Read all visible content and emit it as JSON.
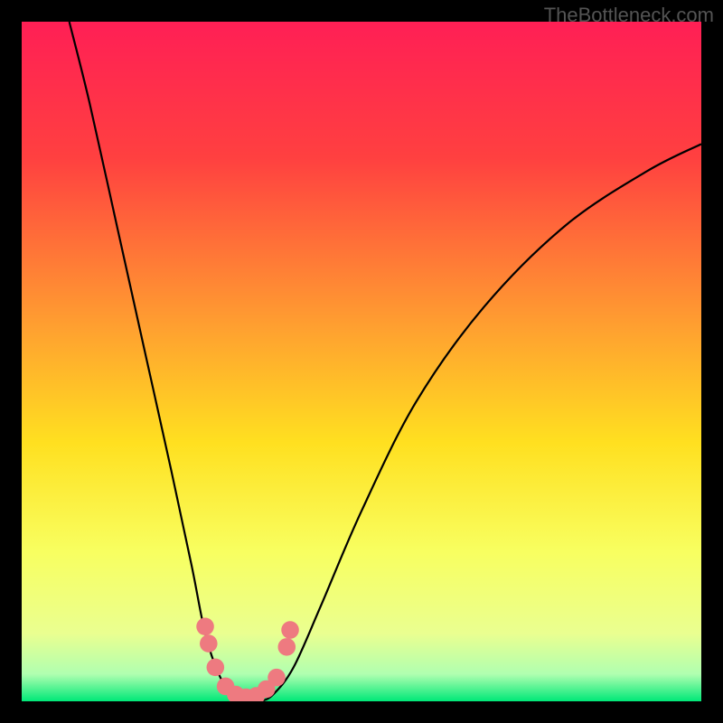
{
  "watermark": "TheBottleneck.com",
  "chart_data": {
    "type": "line",
    "title": "",
    "xlabel": "",
    "ylabel": "",
    "xlim": [
      0,
      100
    ],
    "ylim": [
      0,
      100
    ],
    "gradient_stops": [
      {
        "offset": 0,
        "color": "#ff1f55"
      },
      {
        "offset": 20,
        "color": "#ff4040"
      },
      {
        "offset": 45,
        "color": "#ffa030"
      },
      {
        "offset": 62,
        "color": "#ffe020"
      },
      {
        "offset": 78,
        "color": "#f8ff60"
      },
      {
        "offset": 90,
        "color": "#eaff90"
      },
      {
        "offset": 96,
        "color": "#b0ffb0"
      },
      {
        "offset": 100,
        "color": "#00e878"
      }
    ],
    "series": [
      {
        "name": "curve",
        "stroke": "#000000",
        "points": [
          {
            "x": 7,
            "y": 100
          },
          {
            "x": 10,
            "y": 88
          },
          {
            "x": 14,
            "y": 70
          },
          {
            "x": 18,
            "y": 52
          },
          {
            "x": 22,
            "y": 34
          },
          {
            "x": 25,
            "y": 20
          },
          {
            "x": 27,
            "y": 10
          },
          {
            "x": 29,
            "y": 4
          },
          {
            "x": 31,
            "y": 1
          },
          {
            "x": 33,
            "y": 0
          },
          {
            "x": 35,
            "y": 0
          },
          {
            "x": 37,
            "y": 1
          },
          {
            "x": 40,
            "y": 5
          },
          {
            "x": 44,
            "y": 14
          },
          {
            "x": 50,
            "y": 28
          },
          {
            "x": 58,
            "y": 44
          },
          {
            "x": 68,
            "y": 58
          },
          {
            "x": 80,
            "y": 70
          },
          {
            "x": 92,
            "y": 78
          },
          {
            "x": 100,
            "y": 82
          }
        ]
      }
    ],
    "markers": {
      "color": "#ee7a80",
      "radius": 1.3,
      "points": [
        {
          "x": 27.0,
          "y": 11.0
        },
        {
          "x": 27.5,
          "y": 8.5
        },
        {
          "x": 28.5,
          "y": 5.0
        },
        {
          "x": 30.0,
          "y": 2.2
        },
        {
          "x": 31.5,
          "y": 1.0
        },
        {
          "x": 33.0,
          "y": 0.6
        },
        {
          "x": 34.5,
          "y": 0.8
        },
        {
          "x": 36.0,
          "y": 1.8
        },
        {
          "x": 37.5,
          "y": 3.5
        },
        {
          "x": 39.0,
          "y": 8.0
        },
        {
          "x": 39.5,
          "y": 10.5
        }
      ]
    }
  }
}
